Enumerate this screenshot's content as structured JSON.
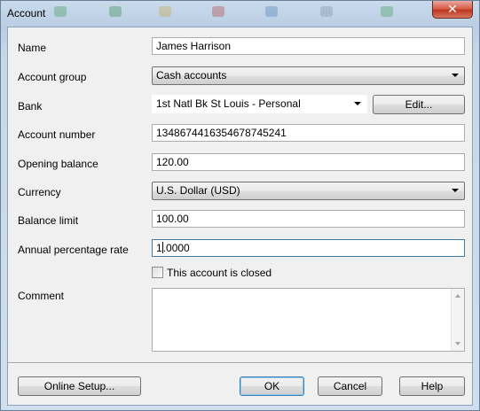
{
  "window": {
    "title": "Account",
    "close_glyph": "✕"
  },
  "form": {
    "name": {
      "label": "Name",
      "value": "James Harrison"
    },
    "account_group": {
      "label": "Account group",
      "value": "Cash accounts"
    },
    "bank": {
      "label": "Bank",
      "value": "1st Natl Bk St Louis - Personal",
      "edit_label": "Edit..."
    },
    "account_number": {
      "label": "Account number",
      "value": "13486744163546787​45241"
    },
    "opening_balance": {
      "label": "Opening balance",
      "value": "120.00"
    },
    "currency": {
      "label": "Currency",
      "value": "U.S. Dollar (USD)"
    },
    "balance_limit": {
      "label": "Balance limit",
      "value": "100.00"
    },
    "apr": {
      "label": "Annual percentage rate",
      "value_before_caret": "1",
      "value_after_caret": ".0000"
    },
    "closed": {
      "label": "This account is closed",
      "checked": false
    },
    "comment": {
      "label": "Comment",
      "value": ""
    }
  },
  "buttons": {
    "online_setup": "Online Setup...",
    "ok": "OK",
    "cancel": "Cancel",
    "help": "Help"
  },
  "colors": {
    "title_gradient_top": "#c9daec",
    "client_bg": "#f0f0f0",
    "close_button": "#c0361f",
    "default_button_border": "#3c7fb1"
  }
}
